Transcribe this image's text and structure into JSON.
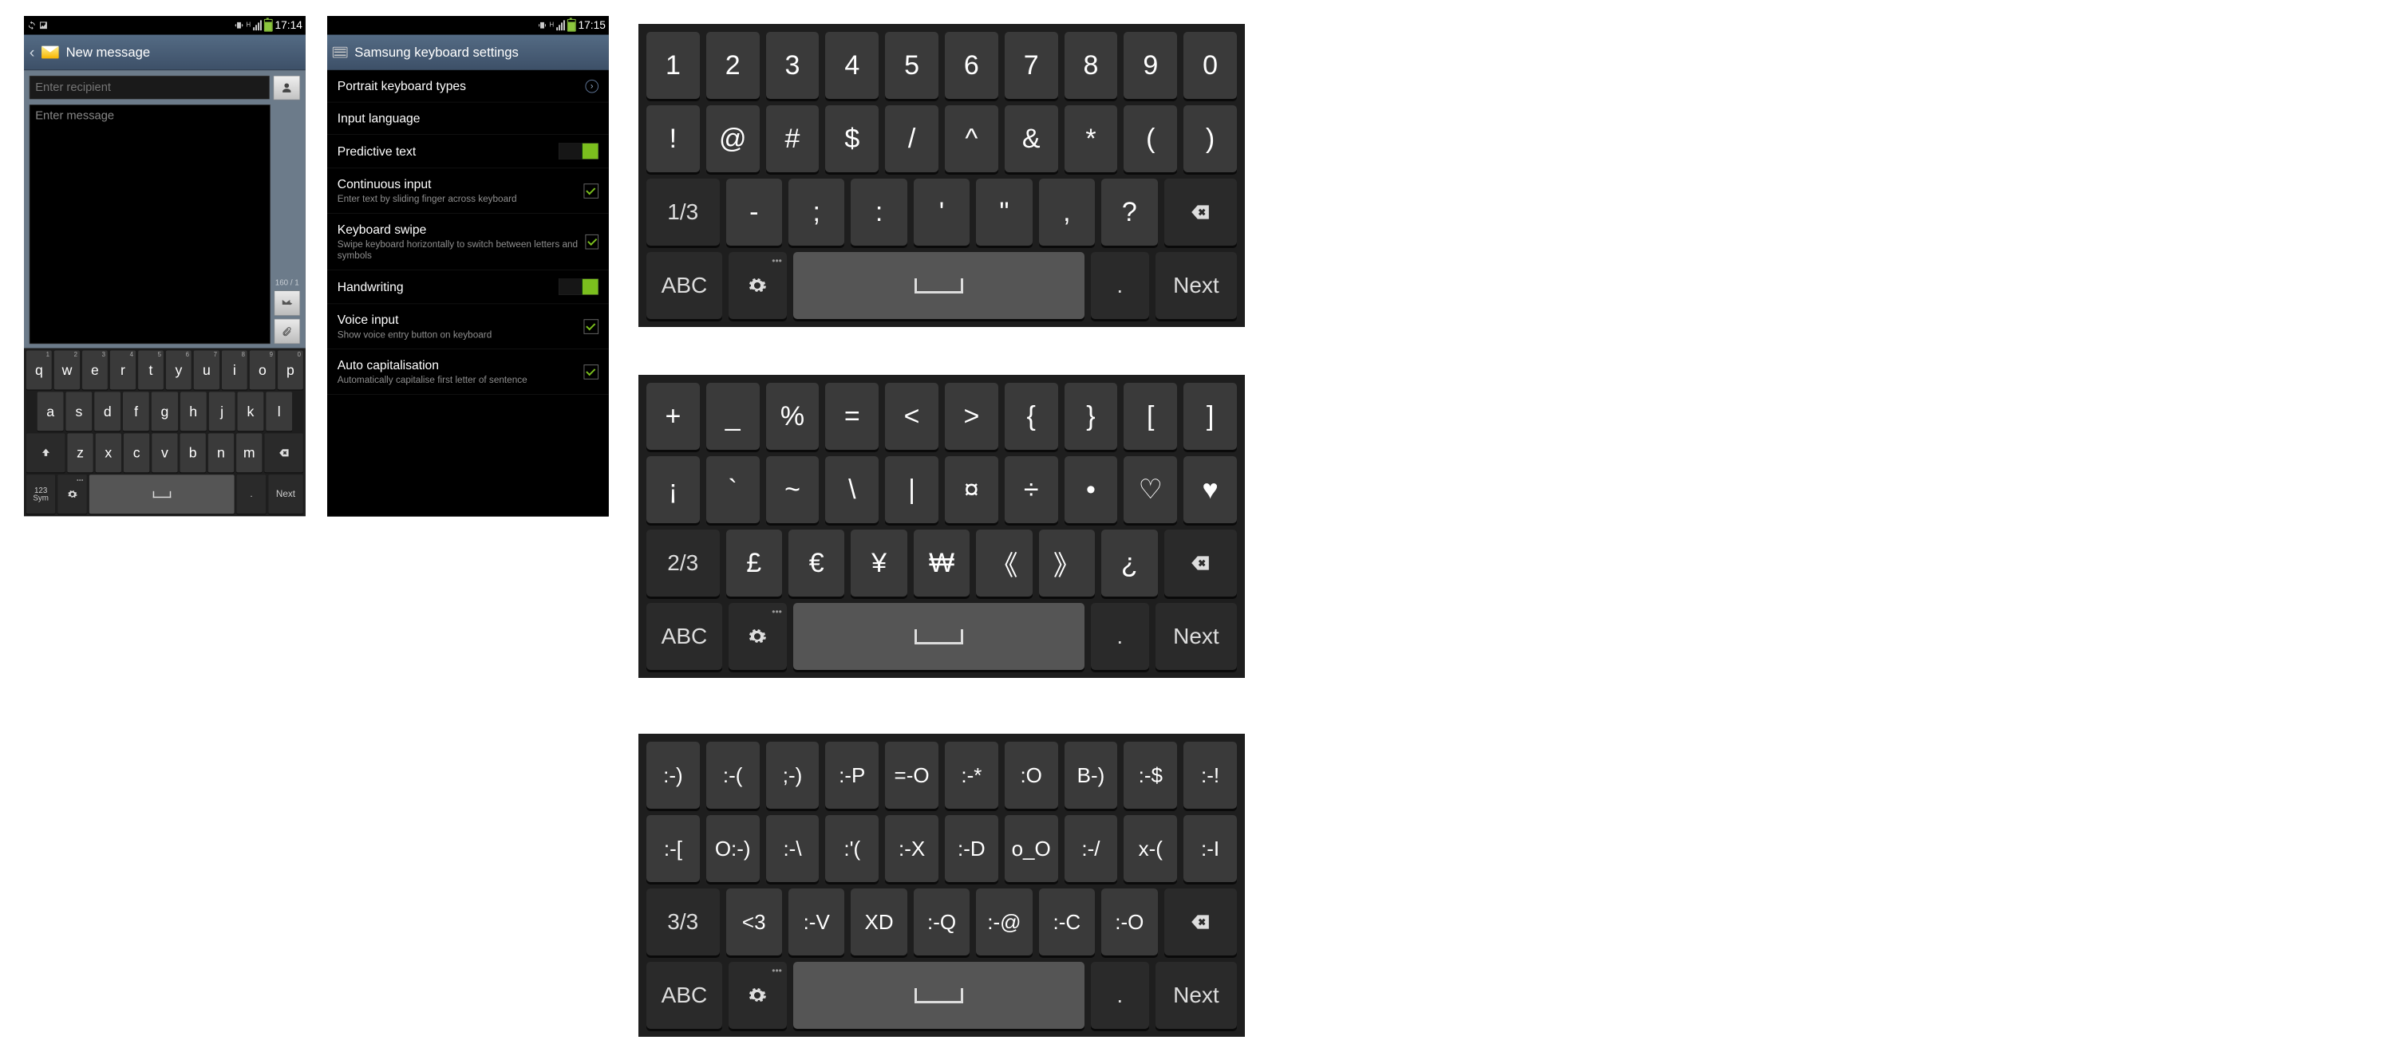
{
  "phone1": {
    "status": {
      "time": "17:14"
    },
    "header": {
      "title": "New message"
    },
    "compose": {
      "recipient_placeholder": "Enter recipient",
      "message_placeholder": "Enter message",
      "char_count": "160 / 1"
    },
    "keyboard": {
      "row1_nums": [
        "1",
        "2",
        "3",
        "4",
        "5",
        "6",
        "7",
        "8",
        "9",
        "0"
      ],
      "row1": [
        "q",
        "w",
        "e",
        "r",
        "t",
        "y",
        "u",
        "i",
        "o",
        "p"
      ],
      "row2": [
        "a",
        "s",
        "d",
        "f",
        "g",
        "h",
        "j",
        "k",
        "l"
      ],
      "row3": [
        "z",
        "x",
        "c",
        "v",
        "b",
        "n",
        "m"
      ],
      "sym_top": "123",
      "sym_bot": "Sym",
      "period": ".",
      "next": "Next"
    }
  },
  "phone2": {
    "status": {
      "time": "17:15"
    },
    "header": {
      "title": "Samsung keyboard settings"
    },
    "items": [
      {
        "title": "Portrait keyboard types",
        "kind": "nav"
      },
      {
        "title": "Input language",
        "kind": "plain"
      },
      {
        "title": "Predictive text",
        "kind": "toggle",
        "on": true
      },
      {
        "title": "Continuous input",
        "sub": "Enter text by sliding finger across keyboard",
        "kind": "check",
        "on": true
      },
      {
        "title": "Keyboard swipe",
        "sub": "Swipe keyboard horizontally to switch between letters and symbols",
        "kind": "check",
        "on": true
      },
      {
        "title": "Handwriting",
        "kind": "toggle",
        "on": true
      },
      {
        "title": "Voice input",
        "sub": "Show voice entry button on keyboard",
        "kind": "check",
        "on": true
      },
      {
        "title": "Auto capitalisation",
        "sub": "Automatically capitalise first letter of sentence",
        "kind": "check",
        "on": true
      }
    ]
  },
  "kbA": {
    "row1": [
      "1",
      "2",
      "3",
      "4",
      "5",
      "6",
      "7",
      "8",
      "9",
      "0"
    ],
    "row2": [
      "!",
      "@",
      "#",
      "$",
      "/",
      "^",
      "&",
      "*",
      "(",
      ")"
    ],
    "row3_page": "1/3",
    "row3": [
      "-",
      ";",
      ":",
      "'",
      "\"",
      ",",
      "?"
    ],
    "row4_abc": "ABC",
    "row4_period": ".",
    "row4_next": "Next"
  },
  "kbB": {
    "row1": [
      "+",
      "_",
      "%",
      "=",
      "<",
      ">",
      "{",
      "}",
      "[",
      "]"
    ],
    "row2": [
      "¡",
      "`",
      "~",
      "\\",
      "|",
      "¤",
      "÷",
      "•",
      "♡",
      "♥"
    ],
    "row3_page": "2/3",
    "row3": [
      "£",
      "€",
      "¥",
      "₩",
      "《",
      "》",
      "¿"
    ],
    "row4_abc": "ABC",
    "row4_period": ".",
    "row4_next": "Next"
  },
  "kbC": {
    "row1": [
      ":-)",
      ":-(",
      ";-)",
      ":-P",
      "=-O",
      ":-*",
      ":O",
      "B-)",
      ":-$",
      ":-!"
    ],
    "row2": [
      ":-[",
      "O:-)",
      ":-\\",
      ":'(",
      ":-X",
      ":-D",
      "o_O",
      ":-/",
      "x-(",
      ":-I"
    ],
    "row3_page": "3/3",
    "row3": [
      "<3",
      ":-V",
      "XD",
      ":-Q",
      ":-@",
      ":-C",
      ":-O"
    ],
    "row4_abc": "ABC",
    "row4_period": ".",
    "row4_next": "Next"
  }
}
